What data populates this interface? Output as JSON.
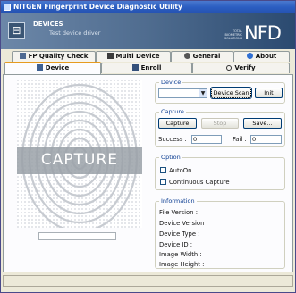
{
  "window": {
    "title": "NITGEN Fingerprint Device Diagnostic Utility"
  },
  "banner": {
    "title": "DEVICES",
    "subtitle": "Test device driver",
    "brand_small": [
      "TOTAL",
      "BIOMETRIC",
      "SOLUTIONS"
    ],
    "brand": "NFD"
  },
  "tabs": {
    "row1": [
      {
        "label": "FP Quality Check",
        "icon": "fingerprint-icon"
      },
      {
        "label": "Multi Device",
        "icon": "multi-device-icon"
      },
      {
        "label": "General",
        "icon": "gear-icon"
      },
      {
        "label": "About",
        "icon": "info-icon"
      }
    ],
    "row2": [
      {
        "label": "Device",
        "icon": "device-icon",
        "active": true
      },
      {
        "label": "Enroll",
        "icon": "enroll-icon"
      },
      {
        "label": "Verify",
        "icon": "search-icon"
      }
    ]
  },
  "capture_panel": {
    "label": "CAPTURE"
  },
  "device_group": {
    "label": "Device",
    "select_value": "",
    "scan_button": "Device Scan",
    "init_button": "Init"
  },
  "capture_group": {
    "label": "Capture",
    "capture_button": "Capture",
    "stop_button": "Stop",
    "save_button": "Save...",
    "success_label": "Success :",
    "success_value": "0",
    "fail_label": "Fail :",
    "fail_value": "0"
  },
  "option_group": {
    "label": "Option",
    "autoon_label": "AutoOn",
    "continuous_label": "Continuous Capture"
  },
  "info_group": {
    "label": "Information",
    "rows": [
      "File Version :",
      "Device Version :",
      "Device Type :",
      "Device ID :",
      "Image Width :",
      "Image Height :"
    ]
  },
  "colors": {
    "titlebar": "#2c5ec1",
    "active_tab": "#e69b1f",
    "group_label": "#0b3d91"
  }
}
